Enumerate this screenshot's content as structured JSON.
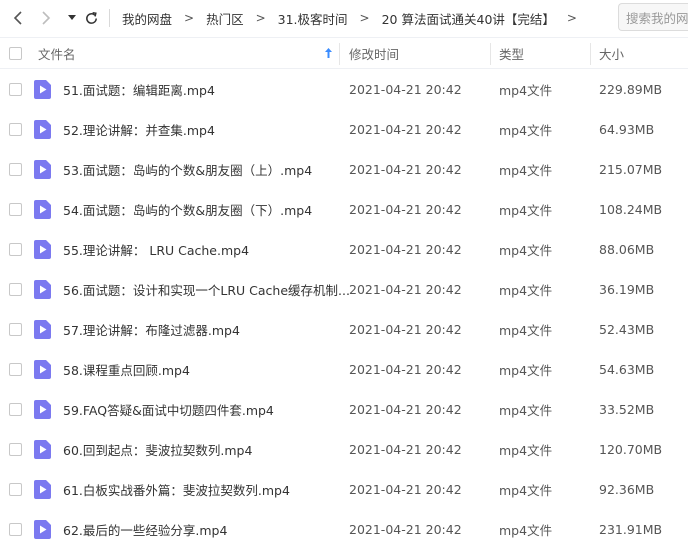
{
  "toolbar": {
    "breadcrumb": [
      "我的网盘",
      "热门区",
      "31.极客时间",
      "20 算法面试通关40讲【完结】"
    ],
    "separator": ">",
    "search_placeholder": "搜索我的网盘"
  },
  "columns": {
    "name": "文件名",
    "modified": "修改时间",
    "type": "类型",
    "size": "大小"
  },
  "colors": {
    "icon_fill": "#7b79f0",
    "sort_arrow": "#3b8cff"
  },
  "files": [
    {
      "name": "51.面试题：编辑距离.mp4",
      "modified": "2021-04-21 20:42",
      "type": "mp4文件",
      "size": "229.89MB"
    },
    {
      "name": "52.理论讲解：并查集.mp4",
      "modified": "2021-04-21 20:42",
      "type": "mp4文件",
      "size": "64.93MB"
    },
    {
      "name": "53.面试题：岛屿的个数&朋友圈（上）.mp4",
      "modified": "2021-04-21 20:42",
      "type": "mp4文件",
      "size": "215.07MB"
    },
    {
      "name": "54.面试题：岛屿的个数&朋友圈（下）.mp4",
      "modified": "2021-04-21 20:42",
      "type": "mp4文件",
      "size": "108.24MB"
    },
    {
      "name": "55.理论讲解： LRU Cache.mp4",
      "modified": "2021-04-21 20:42",
      "type": "mp4文件",
      "size": "88.06MB"
    },
    {
      "name": "56.面试题：设计和实现一个LRU Cache缓存机制...",
      "modified": "2021-04-21 20:42",
      "type": "mp4文件",
      "size": "36.19MB"
    },
    {
      "name": "57.理论讲解：布隆过滤器.mp4",
      "modified": "2021-04-21 20:42",
      "type": "mp4文件",
      "size": "52.43MB"
    },
    {
      "name": "58.课程重点回顾.mp4",
      "modified": "2021-04-21 20:42",
      "type": "mp4文件",
      "size": "54.63MB"
    },
    {
      "name": "59.FAQ答疑&面试中切题四件套.mp4",
      "modified": "2021-04-21 20:42",
      "type": "mp4文件",
      "size": "33.52MB"
    },
    {
      "name": "60.回到起点：斐波拉契数列.mp4",
      "modified": "2021-04-21 20:42",
      "type": "mp4文件",
      "size": "120.70MB"
    },
    {
      "name": "61.白板实战番外篇：斐波拉契数列.mp4",
      "modified": "2021-04-21 20:42",
      "type": "mp4文件",
      "size": "92.36MB"
    },
    {
      "name": "62.最后的一些经验分享.mp4",
      "modified": "2021-04-21 20:42",
      "type": "mp4文件",
      "size": "231.91MB"
    }
  ]
}
